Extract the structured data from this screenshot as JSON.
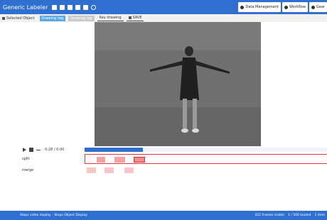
{
  "app": {
    "title": "Generic Labeler"
  },
  "top_buttons": [
    {
      "label": "Data Management",
      "icon": "gear-icon"
    },
    {
      "label": "Workflow",
      "icon": "workflow-icon"
    },
    {
      "label": "Gear",
      "icon": "gear-icon"
    }
  ],
  "toolbar": {
    "selected_object": "Selected Object",
    "mode_active": "Drawing tag",
    "mode_grey": "Drawing tag",
    "mode_outlined": "Key drawing",
    "save": "SAVE"
  },
  "controls": {
    "time": "0:28 / 0:00"
  },
  "tracks": [
    {
      "label": "split"
    },
    {
      "label": "merge"
    }
  ],
  "timeline": {
    "progress": 0.24
  },
  "status": {
    "left": "Steps video display - Steps Object Display",
    "right_1": "422 frames visible",
    "right_2": "1 / 500 loaded",
    "right_3": "1 item"
  },
  "colors": {
    "accent": "#2e6fd0",
    "segment": "#f2a3a3",
    "selection": "#e33333"
  }
}
